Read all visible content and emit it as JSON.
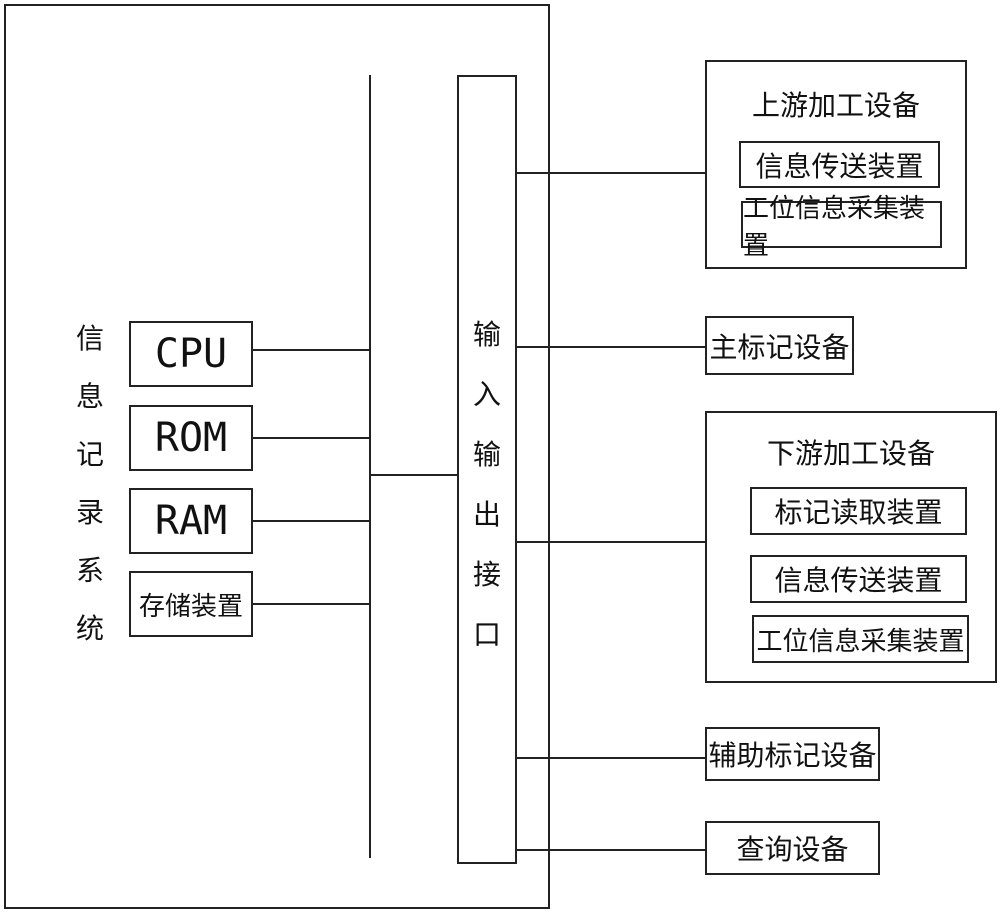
{
  "system": {
    "title_chars": [
      "信",
      "息",
      "记",
      "录",
      "系",
      "统"
    ],
    "components": [
      {
        "label": "CPU"
      },
      {
        "label": "ROM"
      },
      {
        "label": "RAM"
      },
      {
        "label": "存储装置"
      }
    ]
  },
  "io_interface": {
    "chars": [
      "输",
      "入",
      "输",
      "出",
      "接",
      "口"
    ]
  },
  "devices": {
    "upstream": {
      "title": "上游加工设备",
      "subs": [
        "信息传送装置",
        "工位信息采集装置"
      ]
    },
    "main_marker": {
      "label": "主标记设备"
    },
    "downstream": {
      "title": "下游加工设备",
      "subs": [
        "标记读取装置",
        "信息传送装置",
        "工位信息采集装置"
      ]
    },
    "aux_marker": {
      "label": "辅助标记设备"
    },
    "query": {
      "label": "查询设备"
    }
  }
}
